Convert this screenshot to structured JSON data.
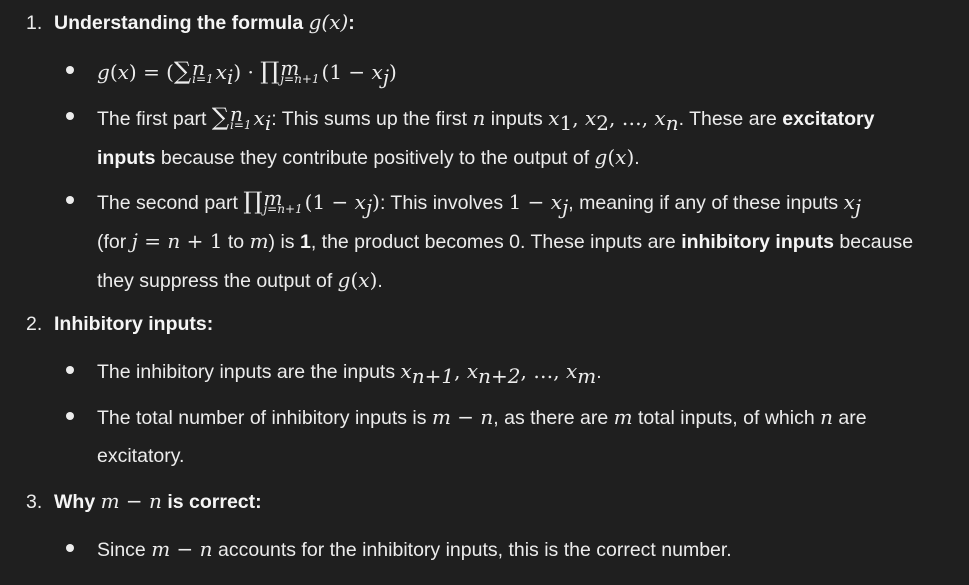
{
  "items": [
    {
      "number": "1.",
      "heading": "Understanding the formula",
      "heading_math": "g(x)",
      "heading_suffix": ":",
      "bullets": [
        {
          "formula": "g(x) = (∑ⁿᵢ₌₁ xᵢ) · ∏ᵐⱼ₌ₙ₊₁(1 − xⱼ)"
        },
        {
          "t1": "The first part",
          "t2": ": This sums up the first",
          "t3": "inputs",
          "t4": ". These are",
          "t5": "excitatory",
          "t6": "inputs",
          "t7": "because they contribute positively to the output of",
          "t8": "."
        },
        {
          "t1": "The second part",
          "t2": ": This involves",
          "t3": ", meaning if any of these inputs",
          "t4": "(for",
          "t5": "to",
          "t6": ") is",
          "t7": "1",
          "t8": ", the product becomes 0. These inputs are",
          "t9": "inhibitory inputs",
          "t10": "because",
          "t11": "they suppress the output of",
          "t12": "."
        }
      ]
    },
    {
      "number": "2.",
      "heading": "Inhibitory inputs:",
      "bullets": [
        {
          "t1": "The inhibitory inputs are the inputs",
          "t2": "."
        },
        {
          "t1": "The total number of inhibitory inputs is",
          "t2": ", as there are",
          "t3": "total inputs, of which",
          "t4": "are",
          "t5": "excitatory."
        }
      ]
    },
    {
      "number": "3.",
      "heading_prefix": "Why",
      "heading_math": "m − n",
      "heading_suffix": "is correct:",
      "bullets": [
        {
          "t1": "Since",
          "t2": "accounts for the inhibitory inputs, this is the correct number."
        }
      ]
    }
  ],
  "math": {
    "g": "g",
    "x": "x",
    "n": "n",
    "m": "m",
    "j": "j",
    "i": "i",
    "one": "1",
    "minus": "−",
    "eq": "=",
    "n_plus_1": "n + 1",
    "m_minus_n": "m − n",
    "ellipsis": "…",
    "lparen": "(",
    "rparen": ")",
    "cdot": "·",
    "sum": "∑",
    "prod": "∏",
    "comma": ","
  },
  "colors": {
    "background": "#1f1f1f",
    "text": "#ececec",
    "bullet": "#ececec"
  }
}
